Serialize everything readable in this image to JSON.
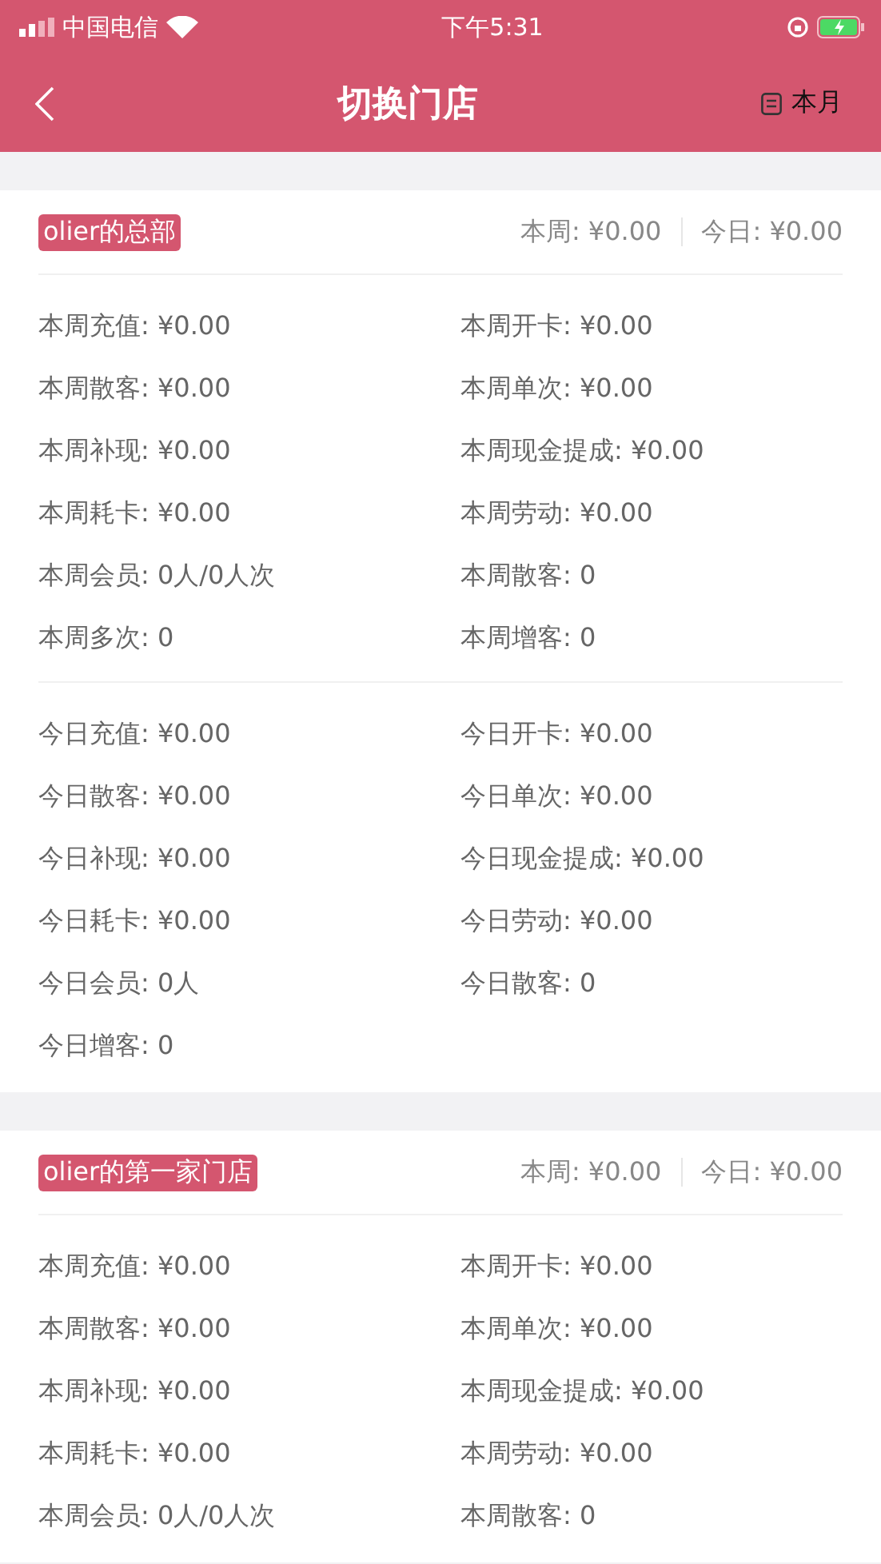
{
  "status_bar": {
    "carrier": "中国电信",
    "time": "下午5:31"
  },
  "nav": {
    "title": "切换门店",
    "period": "本月"
  },
  "stores": [
    {
      "name": "olier的总部",
      "week_total": "本周: ¥0.00",
      "today_total": "今日: ¥0.00",
      "sections": [
        [
          "本周充值: ¥0.00",
          "本周开卡: ¥0.00",
          "本周散客: ¥0.00",
          "本周单次: ¥0.00",
          "本周补现: ¥0.00",
          "本周现金提成: ¥0.00",
          "本周耗卡: ¥0.00",
          "本周劳动: ¥0.00",
          "本周会员: 0人/0人次",
          "本周散客: 0",
          "本周多次: 0",
          "本周增客: 0"
        ],
        [
          "今日充值: ¥0.00",
          "今日开卡: ¥0.00",
          "今日散客: ¥0.00",
          "今日单次: ¥0.00",
          "今日补现: ¥0.00",
          "今日现金提成: ¥0.00",
          "今日耗卡: ¥0.00",
          "今日劳动: ¥0.00",
          "今日会员: 0人",
          "今日散客: 0",
          "今日增客: 0"
        ]
      ]
    },
    {
      "name": "olier的第一家门店",
      "week_total": "本周: ¥0.00",
      "today_total": "今日: ¥0.00",
      "sections": [
        [
          "本周充值: ¥0.00",
          "本周开卡: ¥0.00",
          "本周散客: ¥0.00",
          "本周单次: ¥0.00",
          "本周补现: ¥0.00",
          "本周现金提成: ¥0.00",
          "本周耗卡: ¥0.00",
          "本周劳动: ¥0.00",
          "本周会员: 0人/0人次",
          "本周散客: 0"
        ]
      ]
    }
  ]
}
